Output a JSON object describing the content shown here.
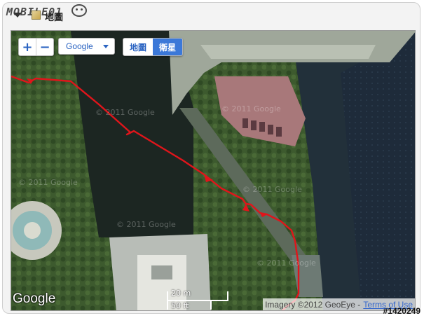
{
  "header": {
    "logo_text": "MOBILE01",
    "map_tab_label": "地圖"
  },
  "map": {
    "controls": {
      "zoom_in": "+",
      "zoom_out": "−",
      "provider_selected": "Google",
      "map_types": [
        "地圖",
        "衛星"
      ],
      "active_map_type": "衛星"
    },
    "google_logo": "Google",
    "scale": {
      "top_label": "20 m",
      "bottom_label": "50 ft"
    },
    "attribution": {
      "imagery_text": "Imagery ©2012 GeoEye -",
      "terms_link": "Terms of Use"
    },
    "route_color": "#e0151b",
    "imagery_watermark": "© 2011 Google"
  },
  "footer": {
    "watermark_id": "#1420249"
  }
}
